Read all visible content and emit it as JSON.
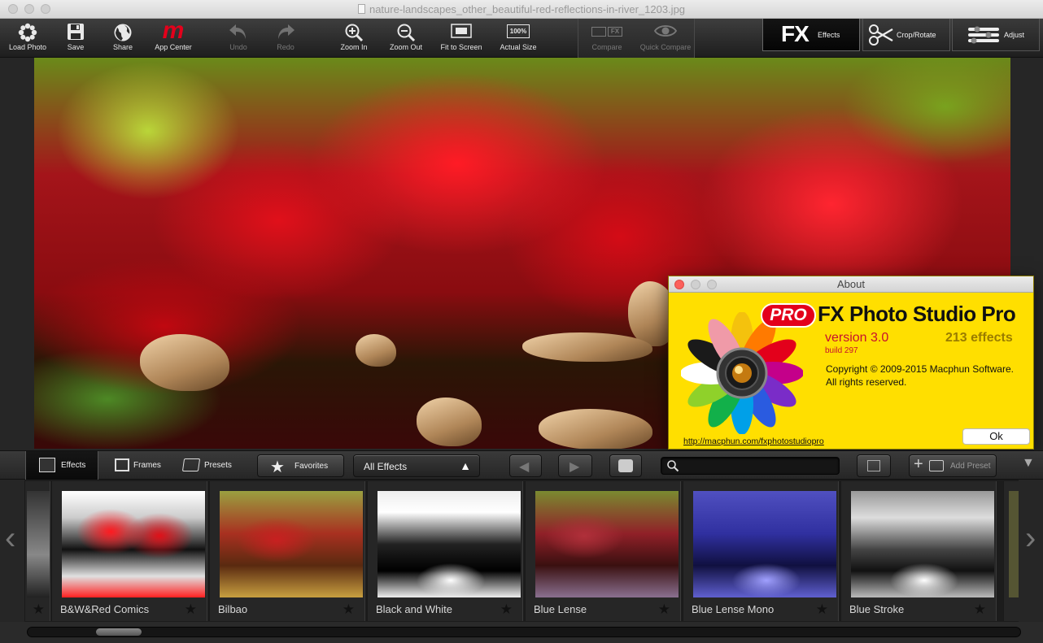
{
  "window": {
    "title": "nature-landscapes_other_beautiful-red-reflections-in-river_1203.jpg"
  },
  "toolbar": {
    "load_photo": "Load Photo",
    "save": "Save",
    "share": "Share",
    "app_center": "App Center",
    "undo": "Undo",
    "redo": "Redo",
    "zoom_in": "Zoom In",
    "zoom_out": "Zoom Out",
    "fit_to_screen": "Fit to Screen",
    "actual_size": "Actual Size",
    "actual_size_badge": "100%",
    "compare": "Compare",
    "compare_badge": "FX",
    "quick_compare": "Quick Compare",
    "app_center_logo": "m"
  },
  "modes": {
    "effects_big": "FX",
    "effects": "Effects",
    "crop_rotate": "Crop/Rotate",
    "adjust": "Adjust"
  },
  "about": {
    "title": "About",
    "badge": "PRO",
    "name": "FX Photo Studio Pro",
    "version": "version 3.0",
    "effects_count": "213 effects",
    "build": "build 297",
    "copyright": "Copyright © 2009-2015 Macphun Software.",
    "rights": "All rights reserved.",
    "link": "http://macphun.com/fxphotostudiopro",
    "ok": "Ok"
  },
  "bottombar": {
    "tab_effects": "Effects",
    "tab_frames": "Frames",
    "tab_presets": "Presets",
    "favorites": "Favorites",
    "dropdown_value": "All Effects",
    "search_placeholder": "",
    "add_preset": "Add Preset"
  },
  "thumbnails": [
    {
      "label": "B&W&Red Comics",
      "style": "bwred"
    },
    {
      "label": "Bilbao",
      "style": "bilbao"
    },
    {
      "label": "Black and White",
      "style": "bw"
    },
    {
      "label": "Blue Lense",
      "style": "bluelense"
    },
    {
      "label": "Blue Lense Mono",
      "style": "bluemono"
    },
    {
      "label": "Blue Stroke",
      "style": "bluestroke"
    }
  ],
  "colors": {
    "about_bg": "#ffdf00",
    "app_center_logo": "#e3001b",
    "version_text": "#c8102e"
  },
  "icons": {
    "load_photo": "flower-icon",
    "save": "floppy-icon",
    "share": "globe-icon",
    "undo": "undo-arrow-icon",
    "redo": "redo-arrow-icon",
    "zoom_in": "magnifier-plus-icon",
    "zoom_out": "magnifier-minus-icon",
    "fit_to_screen": "fit-screen-icon",
    "actual_size": "actual-size-icon",
    "compare": "compare-icon",
    "quick_compare": "eye-icon",
    "crop_rotate": "scissors-icon",
    "adjust": "sliders-icon"
  }
}
